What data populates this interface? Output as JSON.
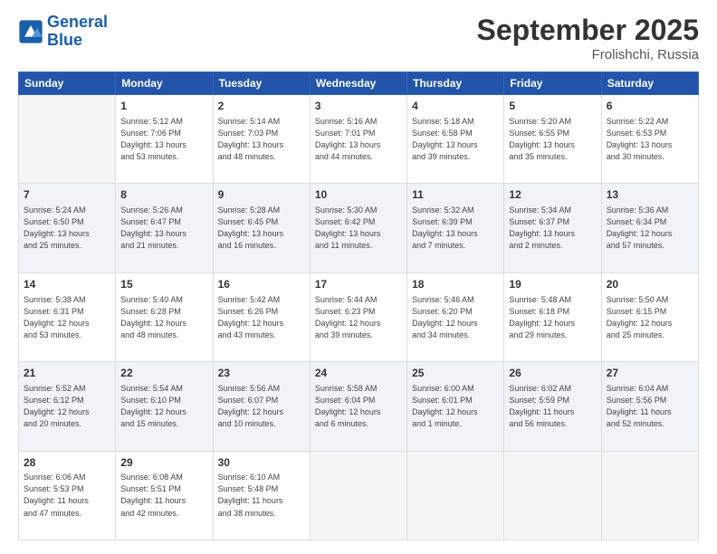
{
  "header": {
    "logo_line1": "General",
    "logo_line2": "Blue",
    "month": "September 2025",
    "location": "Frolishchi, Russia"
  },
  "weekdays": [
    "Sunday",
    "Monday",
    "Tuesday",
    "Wednesday",
    "Thursday",
    "Friday",
    "Saturday"
  ],
  "weeks": [
    [
      {
        "day": "",
        "info": ""
      },
      {
        "day": "1",
        "info": "Sunrise: 5:12 AM\nSunset: 7:06 PM\nDaylight: 13 hours\nand 53 minutes."
      },
      {
        "day": "2",
        "info": "Sunrise: 5:14 AM\nSunset: 7:03 PM\nDaylight: 13 hours\nand 48 minutes."
      },
      {
        "day": "3",
        "info": "Sunrise: 5:16 AM\nSunset: 7:01 PM\nDaylight: 13 hours\nand 44 minutes."
      },
      {
        "day": "4",
        "info": "Sunrise: 5:18 AM\nSunset: 6:58 PM\nDaylight: 13 hours\nand 39 minutes."
      },
      {
        "day": "5",
        "info": "Sunrise: 5:20 AM\nSunset: 6:55 PM\nDaylight: 13 hours\nand 35 minutes."
      },
      {
        "day": "6",
        "info": "Sunrise: 5:22 AM\nSunset: 6:53 PM\nDaylight: 13 hours\nand 30 minutes."
      }
    ],
    [
      {
        "day": "7",
        "info": "Sunrise: 5:24 AM\nSunset: 6:50 PM\nDaylight: 13 hours\nand 25 minutes."
      },
      {
        "day": "8",
        "info": "Sunrise: 5:26 AM\nSunset: 6:47 PM\nDaylight: 13 hours\nand 21 minutes."
      },
      {
        "day": "9",
        "info": "Sunrise: 5:28 AM\nSunset: 6:45 PM\nDaylight: 13 hours\nand 16 minutes."
      },
      {
        "day": "10",
        "info": "Sunrise: 5:30 AM\nSunset: 6:42 PM\nDaylight: 13 hours\nand 11 minutes."
      },
      {
        "day": "11",
        "info": "Sunrise: 5:32 AM\nSunset: 6:39 PM\nDaylight: 13 hours\nand 7 minutes."
      },
      {
        "day": "12",
        "info": "Sunrise: 5:34 AM\nSunset: 6:37 PM\nDaylight: 13 hours\nand 2 minutes."
      },
      {
        "day": "13",
        "info": "Sunrise: 5:36 AM\nSunset: 6:34 PM\nDaylight: 12 hours\nand 57 minutes."
      }
    ],
    [
      {
        "day": "14",
        "info": "Sunrise: 5:38 AM\nSunset: 6:31 PM\nDaylight: 12 hours\nand 53 minutes."
      },
      {
        "day": "15",
        "info": "Sunrise: 5:40 AM\nSunset: 6:28 PM\nDaylight: 12 hours\nand 48 minutes."
      },
      {
        "day": "16",
        "info": "Sunrise: 5:42 AM\nSunset: 6:26 PM\nDaylight: 12 hours\nand 43 minutes."
      },
      {
        "day": "17",
        "info": "Sunrise: 5:44 AM\nSunset: 6:23 PM\nDaylight: 12 hours\nand 39 minutes."
      },
      {
        "day": "18",
        "info": "Sunrise: 5:46 AM\nSunset: 6:20 PM\nDaylight: 12 hours\nand 34 minutes."
      },
      {
        "day": "19",
        "info": "Sunrise: 5:48 AM\nSunset: 6:18 PM\nDaylight: 12 hours\nand 29 minutes."
      },
      {
        "day": "20",
        "info": "Sunrise: 5:50 AM\nSunset: 6:15 PM\nDaylight: 12 hours\nand 25 minutes."
      }
    ],
    [
      {
        "day": "21",
        "info": "Sunrise: 5:52 AM\nSunset: 6:12 PM\nDaylight: 12 hours\nand 20 minutes."
      },
      {
        "day": "22",
        "info": "Sunrise: 5:54 AM\nSunset: 6:10 PM\nDaylight: 12 hours\nand 15 minutes."
      },
      {
        "day": "23",
        "info": "Sunrise: 5:56 AM\nSunset: 6:07 PM\nDaylight: 12 hours\nand 10 minutes."
      },
      {
        "day": "24",
        "info": "Sunrise: 5:58 AM\nSunset: 6:04 PM\nDaylight: 12 hours\nand 6 minutes."
      },
      {
        "day": "25",
        "info": "Sunrise: 6:00 AM\nSunset: 6:01 PM\nDaylight: 12 hours\nand 1 minute."
      },
      {
        "day": "26",
        "info": "Sunrise: 6:02 AM\nSunset: 5:59 PM\nDaylight: 11 hours\nand 56 minutes."
      },
      {
        "day": "27",
        "info": "Sunrise: 6:04 AM\nSunset: 5:56 PM\nDaylight: 11 hours\nand 52 minutes."
      }
    ],
    [
      {
        "day": "28",
        "info": "Sunrise: 6:06 AM\nSunset: 5:53 PM\nDaylight: 11 hours\nand 47 minutes."
      },
      {
        "day": "29",
        "info": "Sunrise: 6:08 AM\nSunset: 5:51 PM\nDaylight: 11 hours\nand 42 minutes."
      },
      {
        "day": "30",
        "info": "Sunrise: 6:10 AM\nSunset: 5:48 PM\nDaylight: 11 hours\nand 38 minutes."
      },
      {
        "day": "",
        "info": ""
      },
      {
        "day": "",
        "info": ""
      },
      {
        "day": "",
        "info": ""
      },
      {
        "day": "",
        "info": ""
      }
    ]
  ]
}
